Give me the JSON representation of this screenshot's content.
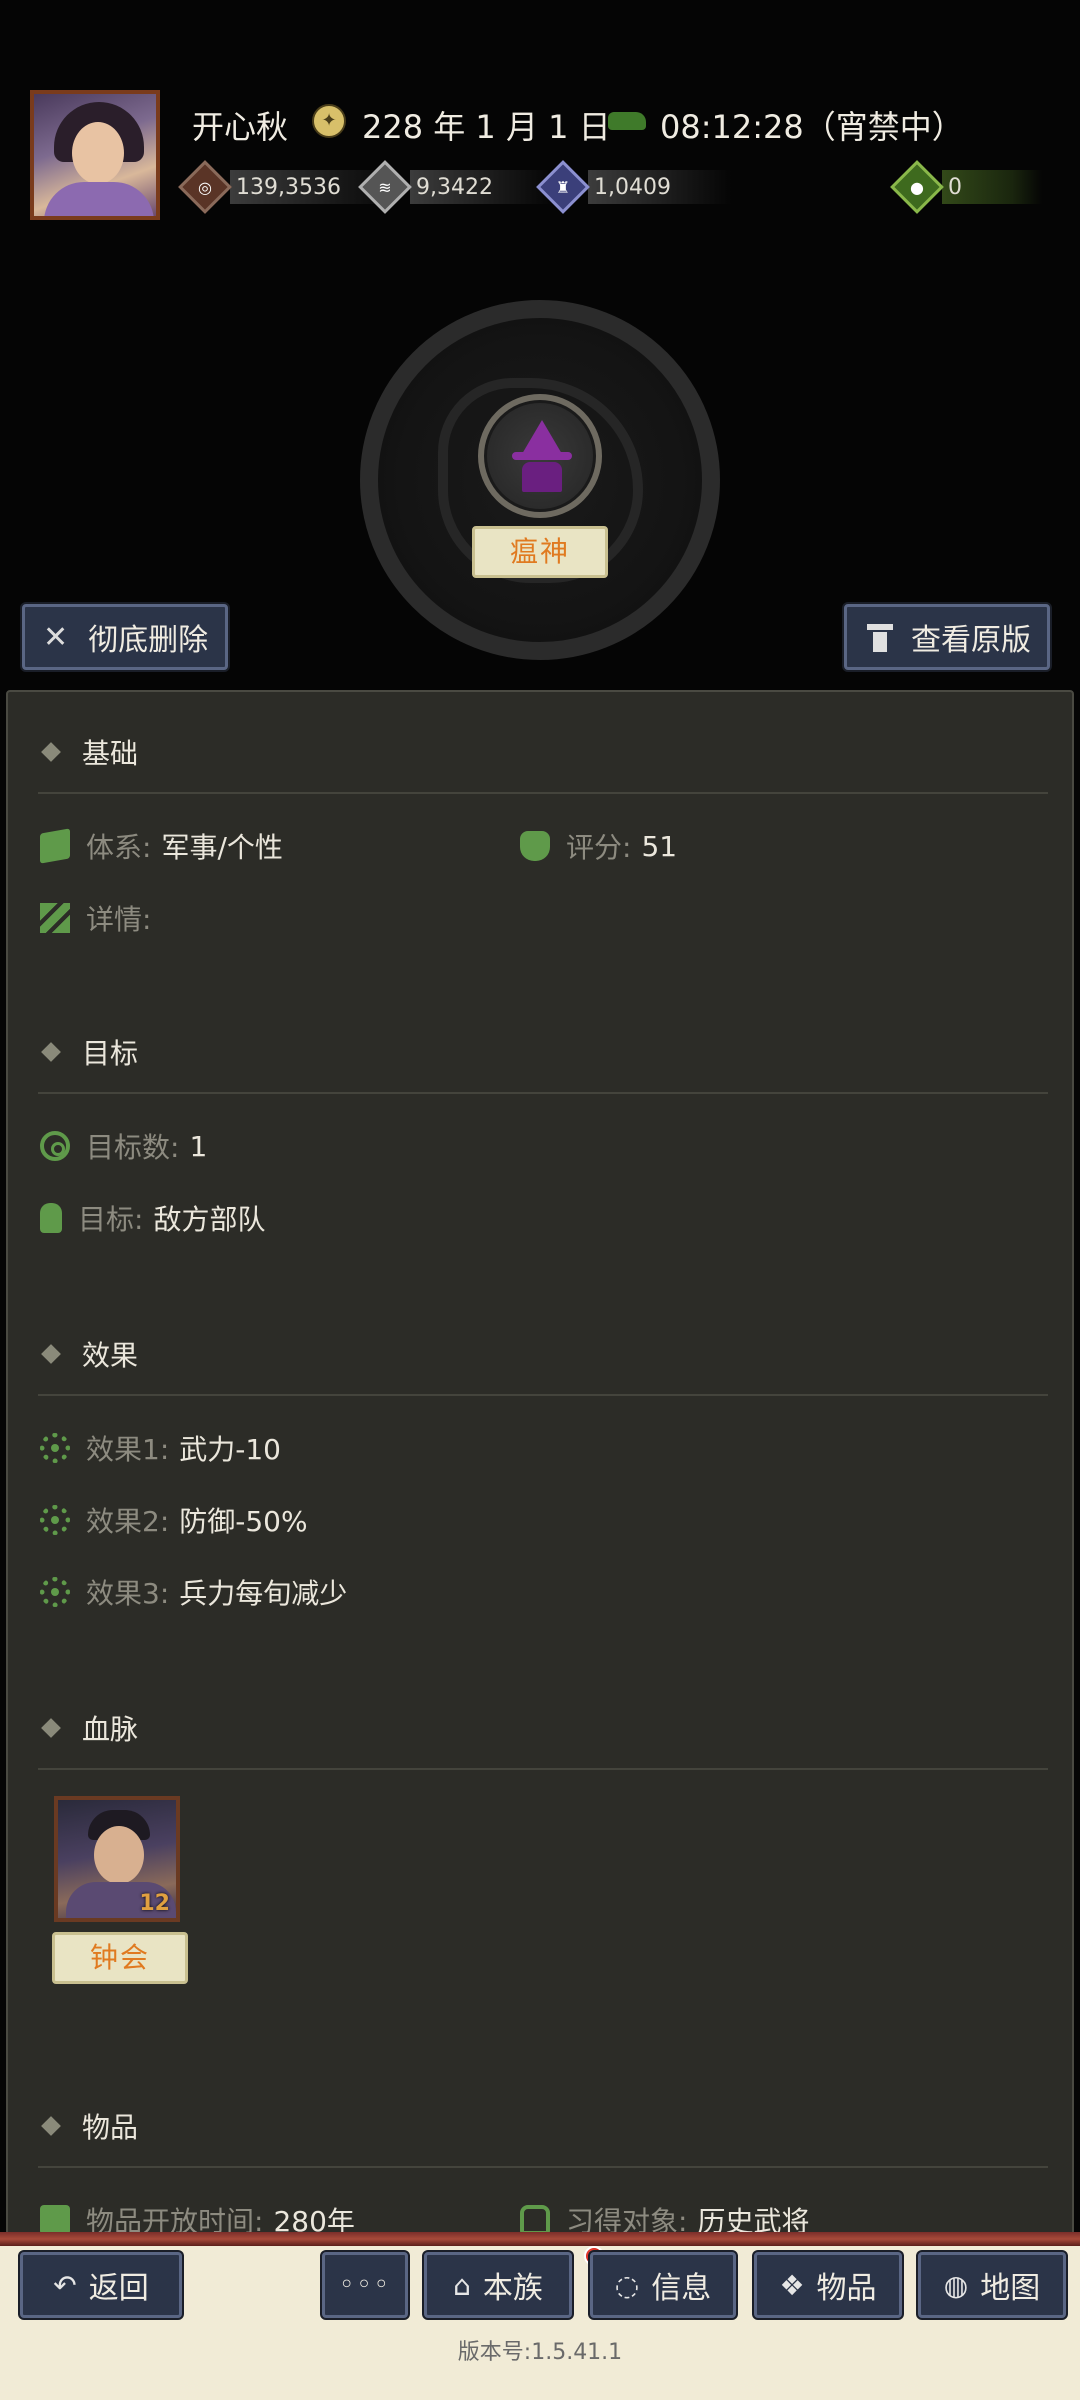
{
  "header": {
    "username": "开心秋",
    "date": "228 年 1 月 1 日",
    "time": "08:12:28（宵禁中）",
    "resources": {
      "coins": "139,3536",
      "grain": "9,3422",
      "troops": "1,0409",
      "gems": "0"
    },
    "icons": {
      "date": "calendar-seal-icon",
      "time": "horse-icon",
      "coins": "coin-icon",
      "grain": "grain-icon",
      "troops": "troops-icon",
      "gems": "gem-pouch-icon"
    }
  },
  "skill": {
    "name": "瘟神",
    "icon": "plague-god-icon",
    "icon_color": "#8a2fa0"
  },
  "actions": {
    "delete_label": "彻底删除",
    "view_original_label": "查看原版"
  },
  "sections": {
    "basic": {
      "title": "基础",
      "system_label": "体系:",
      "system_value": "军事/个性",
      "score_label": "评分:",
      "score_value": "51",
      "detail_label": "详情:"
    },
    "target": {
      "title": "目标",
      "count_label": "目标数:",
      "count_value": "1",
      "target_label": "目标:",
      "target_value": "敌方部队"
    },
    "effects": {
      "title": "效果",
      "items": [
        {
          "label": "效果1:",
          "value": "武力-10"
        },
        {
          "label": "效果2:",
          "value": "防御-50%"
        },
        {
          "label": "效果3:",
          "value": "兵力每旬减少"
        }
      ]
    },
    "bloodline": {
      "title": "血脉",
      "hero_name": "钟会",
      "hero_level": "12"
    },
    "items": {
      "title": "物品",
      "open_time_label": "物品开放时间:",
      "open_time_value": "280年",
      "learn_label": "习得对象:",
      "learn_value": "历史武将"
    }
  },
  "nav": {
    "back": "返回",
    "more": "◦◦◦",
    "clan": "本族",
    "info": "信息",
    "items": "物品",
    "map": "地图"
  },
  "version": "版本号:1.5.41.1",
  "colors": {
    "accent_orange": "#e07a20",
    "icon_green": "#5f9a4a",
    "button_blue": "#2b3448"
  }
}
